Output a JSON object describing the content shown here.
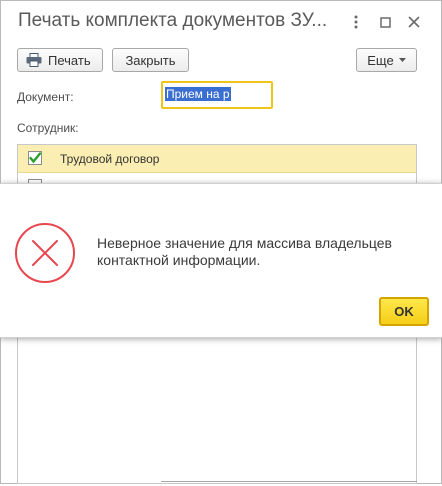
{
  "window": {
    "title": "Печать комплекта документов ЗУ..."
  },
  "toolbar": {
    "print_label": "Печать",
    "close_label": "Закрыть",
    "more_label": "Еще"
  },
  "form": {
    "document_label": "Документ:",
    "document_value": "Прием на р",
    "employee_label": "Сотрудник:"
  },
  "list": {
    "items": [
      {
        "label": "Трудовой договор",
        "checked": true
      }
    ]
  },
  "dialog": {
    "message": "Неверное значение для массива владельцев контактной информации.",
    "ok_label": "OK"
  },
  "colors": {
    "accent_yellow": "#f5cf18",
    "selection_blue": "#3a6fd1",
    "error_red": "#e8464f",
    "row_highlight": "#fbeeb2"
  }
}
